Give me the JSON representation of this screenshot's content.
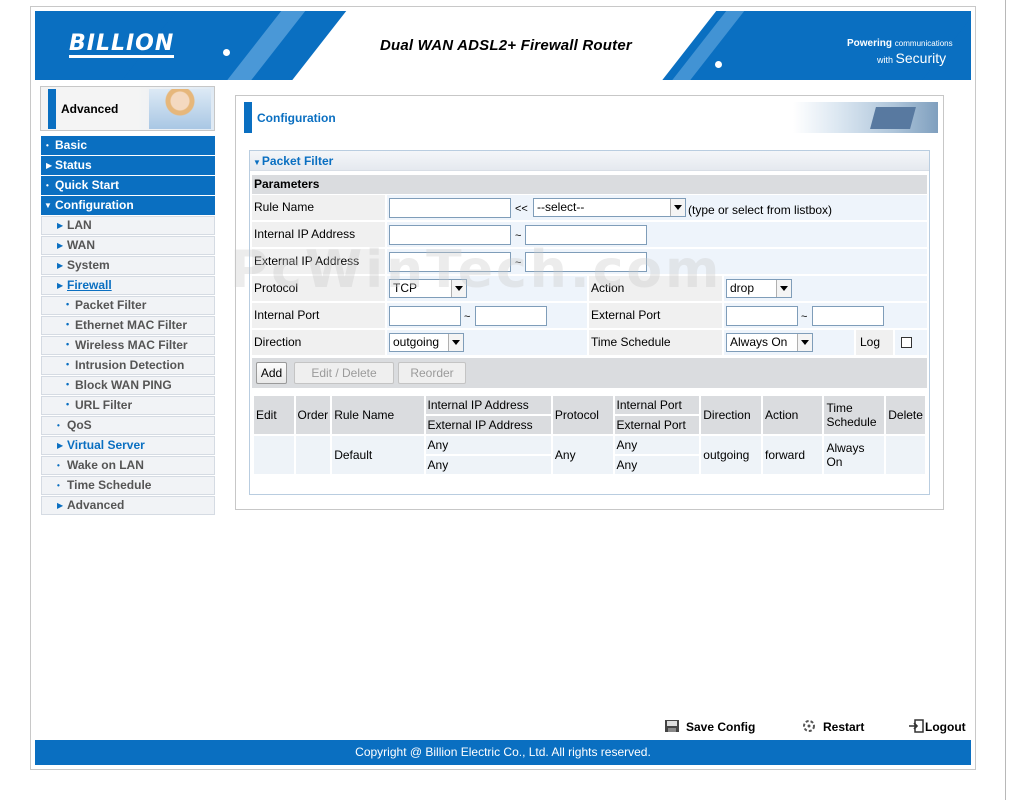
{
  "header": {
    "logo": "BILLION",
    "title": "Dual WAN ADSL2+ Firewall Router",
    "tagline_top": "Powering",
    "tagline_top_small": "communications",
    "tagline_bottom": "with",
    "tagline_bottom_big": "Security"
  },
  "sidebar": {
    "mode_label": "Advanced",
    "items": [
      {
        "label": "Basic"
      },
      {
        "label": "Status"
      },
      {
        "label": "Quick Start"
      },
      {
        "label": "Configuration"
      },
      {
        "label": "LAN"
      },
      {
        "label": "WAN"
      },
      {
        "label": "System"
      },
      {
        "label": "Firewall"
      },
      {
        "label": "Packet Filter"
      },
      {
        "label": "Ethernet MAC Filter"
      },
      {
        "label": "Wireless MAC Filter"
      },
      {
        "label": "Intrusion Detection"
      },
      {
        "label": "Block WAN PING"
      },
      {
        "label": "URL Filter"
      },
      {
        "label": "QoS"
      },
      {
        "label": "Virtual Server"
      },
      {
        "label": "Wake on LAN"
      },
      {
        "label": "Time Schedule"
      },
      {
        "label": "Advanced"
      }
    ]
  },
  "main": {
    "section_title": "Configuration",
    "panel_title": "Packet Filter",
    "params_title": "Parameters",
    "form": {
      "rule_name_label": "Rule Name",
      "rule_name_value": "",
      "rule_name_sep": "<<",
      "rule_select_value": "--select--",
      "rule_hint": "(type or select from listbox)",
      "internal_ip_label": "Internal IP Address",
      "external_ip_label": "External IP Address",
      "tilde": "~",
      "protocol_label": "Protocol",
      "protocol_value": "TCP",
      "action_label": "Action",
      "action_value": "drop",
      "internal_port_label": "Internal Port",
      "external_port_label": "External Port",
      "direction_label": "Direction",
      "direction_value": "outgoing",
      "time_schedule_label": "Time Schedule",
      "time_schedule_value": "Always On",
      "log_label": "Log"
    },
    "buttons": {
      "add": "Add",
      "edit_delete": "Edit / Delete",
      "reorder": "Reorder"
    },
    "table": {
      "headers": {
        "edit": "Edit",
        "order": "Order",
        "rule_name": "Rule Name",
        "internal_ip": "Internal IP Address",
        "external_ip": "External IP Address",
        "protocol": "Protocol",
        "internal_port": "Internal Port",
        "external_port": "External Port",
        "direction": "Direction",
        "action": "Action",
        "time_schedule_1": "Time",
        "time_schedule_2": "Schedule",
        "delete": "Delete"
      },
      "rows": [
        {
          "edit": "",
          "order": "",
          "rule_name": "Default",
          "internal_ip": "Any",
          "external_ip": "Any",
          "protocol": "Any",
          "internal_port": "Any",
          "external_port": "Any",
          "direction": "outgoing",
          "action": "forward",
          "time_schedule": "Always On",
          "delete": ""
        }
      ]
    }
  },
  "watermark": "PcWinTech.com",
  "bottom_bar": {
    "save": "Save Config",
    "restart": "Restart",
    "logout": "Logout"
  },
  "footer": {
    "copyright": "Copyright @ Billion Electric Co., Ltd. All rights reserved."
  },
  "colors": {
    "accent": "#0a6fc1",
    "label_bg": "#f0f0f0",
    "value_bg": "#eef4fb",
    "header_bg": "#dadcdf"
  }
}
